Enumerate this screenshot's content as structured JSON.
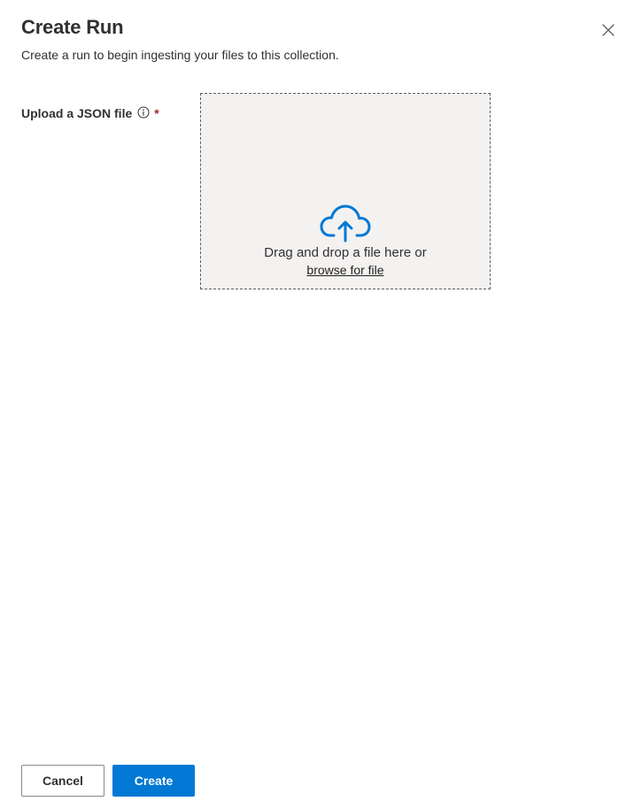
{
  "dialog": {
    "title": "Create Run",
    "subtitle": "Create a run to begin ingesting your files to this collection.",
    "close_icon": "close-icon"
  },
  "upload_field": {
    "label": "Upload a JSON file",
    "info_icon": "info-icon",
    "required_marker": "*",
    "dropzone": {
      "icon": "cloud-upload-icon",
      "drop_text": "Drag and drop a file here or",
      "browse_text": "browse for file"
    }
  },
  "footer": {
    "cancel_label": "Cancel",
    "create_label": "Create"
  },
  "colors": {
    "accent": "#0078d4",
    "required": "#a4262c",
    "dropzone_bg": "#f3f2f1"
  }
}
